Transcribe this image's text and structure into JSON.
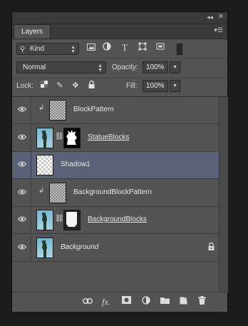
{
  "panel": {
    "collapse_glyph": "◂◂",
    "close_glyph": "✕",
    "tab_label": "Layers",
    "panel_menu_glyph": "▾☰"
  },
  "filter": {
    "kind_label": "Kind",
    "icons": [
      "image-filter-icon",
      "adjustment-filter-icon",
      "type-filter-icon",
      "shape-filter-icon",
      "smart-object-filter-icon"
    ]
  },
  "blend": {
    "mode": "Normal",
    "opacity_label": "Opacity:",
    "opacity_value": "100%"
  },
  "lock": {
    "lock_label": "Lock:",
    "fill_label": "Fill:",
    "fill_value": "100%"
  },
  "layers": [
    {
      "name": "BlockPattern",
      "clipped": true,
      "thumb": "pattern",
      "mask": false,
      "active": false,
      "underlined": false,
      "italic": false,
      "locked": false
    },
    {
      "name": "StatueBlocks",
      "clipped": false,
      "thumb": "statue",
      "mask": "bw",
      "active": false,
      "underlined": true,
      "italic": false,
      "locked": false
    },
    {
      "name": "Shadow1",
      "clipped": false,
      "thumb": "transparent",
      "mask": false,
      "active": true,
      "underlined": false,
      "italic": false,
      "locked": false
    },
    {
      "name": "BackgroundBlockPattern",
      "clipped": true,
      "thumb": "pattern",
      "mask": false,
      "active": false,
      "underlined": false,
      "italic": false,
      "locked": false
    },
    {
      "name": "BackgroundBlocks",
      "clipped": false,
      "thumb": "statue",
      "mask": "white",
      "active": false,
      "underlined": true,
      "italic": false,
      "locked": false
    },
    {
      "name": "Background",
      "clipped": false,
      "thumb": "statue",
      "mask": false,
      "active": false,
      "underlined": false,
      "italic": true,
      "locked": true
    }
  ],
  "footer_icons": [
    "link-layers-icon",
    "fx-icon",
    "add-mask-icon",
    "adjustment-layer-icon",
    "new-group-icon",
    "new-layer-icon",
    "delete-layer-icon"
  ],
  "footer_fx_label": "fx."
}
